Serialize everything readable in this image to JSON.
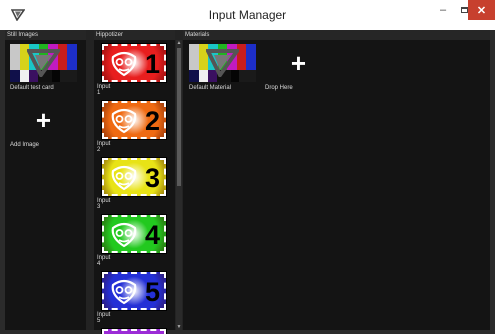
{
  "window": {
    "title": "Input Manager",
    "minimize_glyph": "–",
    "close_glyph": "✕"
  },
  "still_images": {
    "header": "Still Images",
    "items": [
      {
        "label": "Default test card"
      }
    ],
    "add_label": "Add Image",
    "add_glyph": "+"
  },
  "hippotizer": {
    "header": "Hippotizer",
    "inputs": [
      {
        "label": "Input 1",
        "number": "1",
        "color": "#e81e1e",
        "icon": "hippo-mask-icon"
      },
      {
        "label": "Input 2",
        "number": "2",
        "color": "#ef6a12",
        "icon": "hippo-mask-icon"
      },
      {
        "label": "Input 3",
        "number": "3",
        "color": "#e8e316",
        "icon": "hippo-mask-icon"
      },
      {
        "label": "Input 4",
        "number": "4",
        "color": "#22c91f",
        "icon": "hippo-mask-icon"
      },
      {
        "label": "Input 5",
        "number": "5",
        "color": "#2430d6",
        "icon": "hippo-mask-icon"
      }
    ],
    "partial_next_color": "#9b2bd6"
  },
  "materials": {
    "header": "Materials",
    "items": [
      {
        "label": "Default Material"
      }
    ],
    "drop_label": "Drop Here",
    "drop_glyph": "+"
  },
  "scroll": {
    "up_glyph": "▲",
    "down_glyph": "▼"
  },
  "colors": {
    "titlebar": "#ffffff",
    "close_button": "#c7402e",
    "panel_bg": "#141414",
    "window_bg": "#2b2b2b"
  }
}
